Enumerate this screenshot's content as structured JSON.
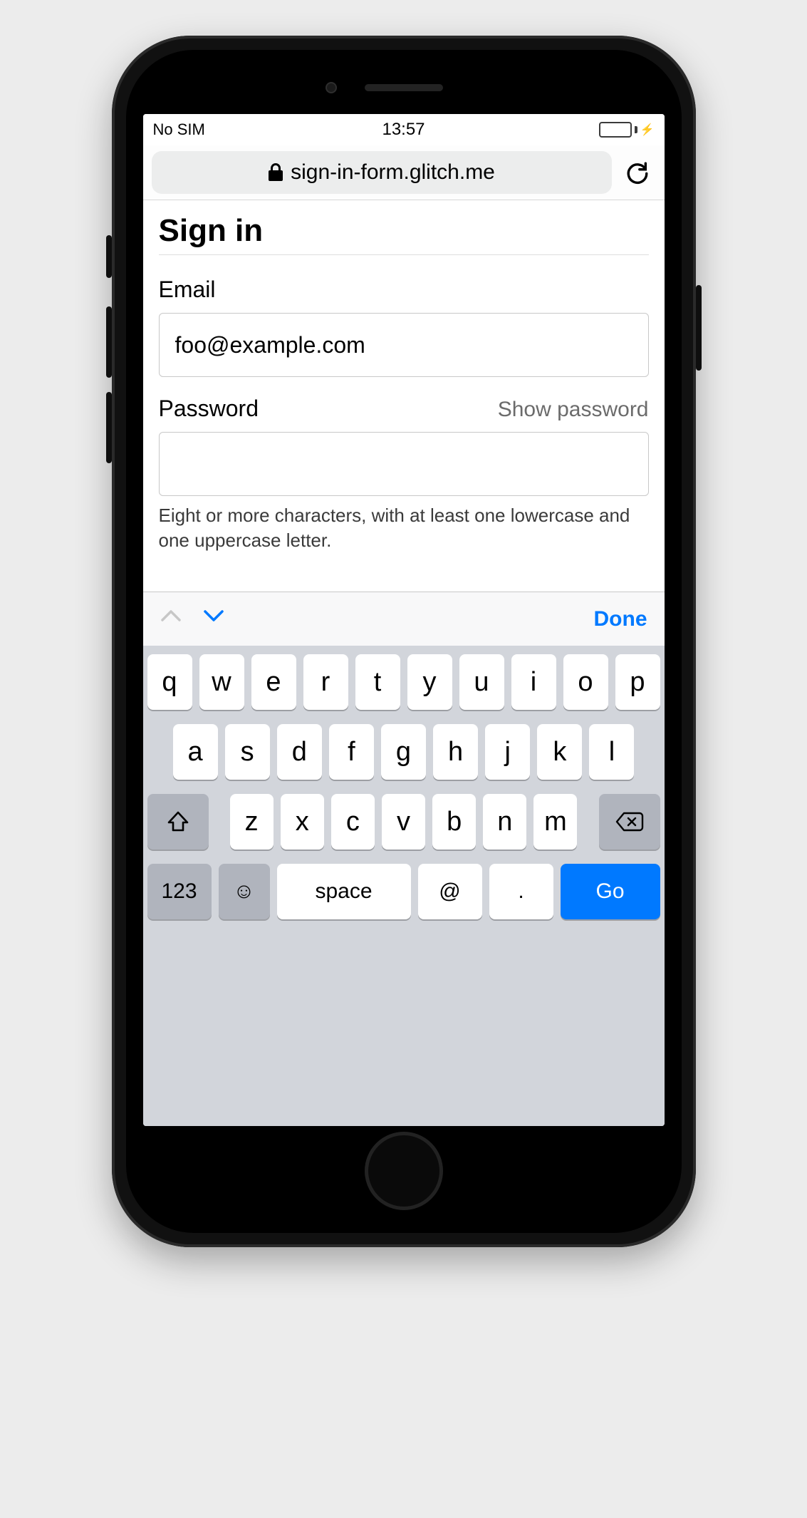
{
  "status": {
    "carrier": "No SIM",
    "time": "13:57"
  },
  "browser": {
    "url": "sign-in-form.glitch.me"
  },
  "page": {
    "title": "Sign in",
    "email_label": "Email",
    "email_value": "foo@example.com",
    "password_label": "Password",
    "show_password": "Show password",
    "password_value": "",
    "hint": "Eight or more characters, with at least one lowercase and one uppercase letter."
  },
  "accessory": {
    "done": "Done"
  },
  "keyboard": {
    "row1": [
      "q",
      "w",
      "e",
      "r",
      "t",
      "y",
      "u",
      "i",
      "o",
      "p"
    ],
    "row2": [
      "a",
      "s",
      "d",
      "f",
      "g",
      "h",
      "j",
      "k",
      "l"
    ],
    "row3": [
      "z",
      "x",
      "c",
      "v",
      "b",
      "n",
      "m"
    ],
    "k123": "123",
    "space": "space",
    "at": "@",
    "dot": ".",
    "go": "Go"
  }
}
